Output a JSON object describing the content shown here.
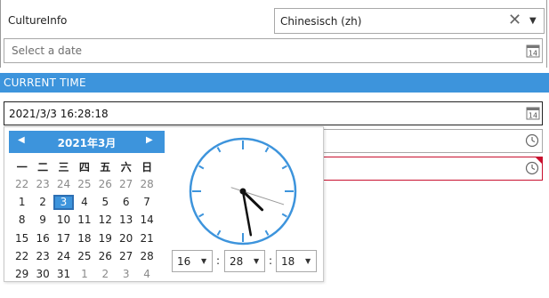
{
  "culture": {
    "label": "CultureInfo",
    "selected": "Chinesisch (zh)",
    "clear_glyph": "✕",
    "arrow_glyph": "▼"
  },
  "date_picker": {
    "placeholder": "Select a date",
    "icon": "calendar-icon",
    "icon_number": "14"
  },
  "section": {
    "title": "CURRENT TIME"
  },
  "time_picker": {
    "value": "2021/3/3 16:28:18",
    "icon": "calendar-icon",
    "icon_number": "14"
  },
  "calendar": {
    "title": "2021年3月",
    "prev_glyph": "◀",
    "next_glyph": "▶",
    "weekdays": [
      "一",
      "二",
      "三",
      "四",
      "五",
      "六",
      "日"
    ],
    "days": [
      [
        "22",
        "23",
        "24",
        "25",
        "26",
        "27",
        "28"
      ],
      [
        "1",
        "2",
        "3",
        "4",
        "5",
        "6",
        "7"
      ],
      [
        "8",
        "9",
        "10",
        "11",
        "12",
        "13",
        "14"
      ],
      [
        "15",
        "16",
        "17",
        "18",
        "19",
        "20",
        "21"
      ],
      [
        "22",
        "23",
        "24",
        "25",
        "26",
        "27",
        "28"
      ],
      [
        "29",
        "30",
        "31",
        "1",
        "2",
        "3",
        "4"
      ]
    ],
    "other_month_days": [
      [
        0,
        0
      ],
      [
        0,
        1
      ],
      [
        0,
        2
      ],
      [
        0,
        3
      ],
      [
        0,
        4
      ],
      [
        0,
        5
      ],
      [
        0,
        6
      ],
      [
        5,
        3
      ],
      [
        5,
        4
      ],
      [
        5,
        5
      ],
      [
        5,
        6
      ]
    ],
    "selected_day": [
      1,
      2
    ]
  },
  "clock": {
    "hour": 16,
    "minute": 28,
    "second": 18
  },
  "time_spinners": {
    "hour": "16",
    "minute": "28",
    "second": "18",
    "separator": ":",
    "arrow_glyph": "▼"
  },
  "colors": {
    "accent": "#3d94dc",
    "error": "#c8102e",
    "clock_stroke": "#3d94dc"
  }
}
